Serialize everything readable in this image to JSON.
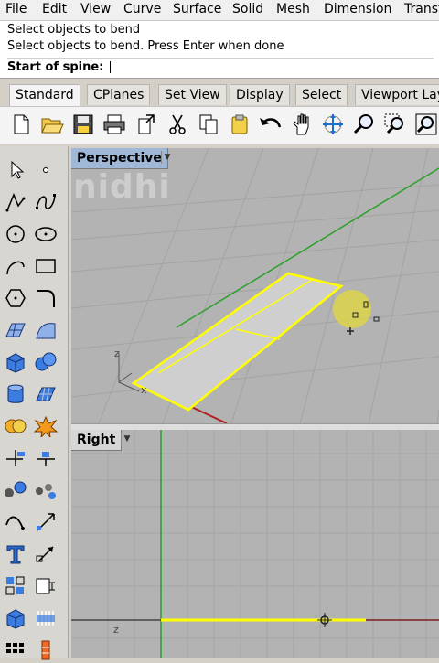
{
  "menu": [
    "File",
    "Edit",
    "View",
    "Curve",
    "Surface",
    "Solid",
    "Mesh",
    "Dimension",
    "Transf"
  ],
  "command_history": [
    "Select objects to bend",
    "Select objects to bend. Press Enter when done"
  ],
  "command_prompt": "Start of spine:",
  "command_input_value": "",
  "tabs": [
    "Standard",
    "CPlanes",
    "Set View",
    "Display",
    "Select",
    "Viewport Layo"
  ],
  "active_tab": "Standard",
  "toolbar_icons": [
    "new-icon",
    "open-icon",
    "save-icon",
    "print-icon",
    "import-icon",
    "cut-icon",
    "copy-icon",
    "paste-icon",
    "undo-icon",
    "pan-icon",
    "rotate-view-icon",
    "zoom-icon",
    "zoom-window-icon",
    "zoom-extents-icon"
  ],
  "sidebar_icons": [
    "select-arrow-icon",
    "point-icon",
    "polyline-icon",
    "curve-icon",
    "circle-icon",
    "ellipse-icon",
    "arc-icon",
    "rectangle-icon",
    "polygon-icon",
    "fillet-curve-icon",
    "surface-points-icon",
    "surface-edge-icon",
    "box-icon",
    "sphere-icon",
    "cylinder-icon",
    "network-surface-icon",
    "boolean-icon",
    "explode-icon",
    "trim-icon",
    "split-icon",
    "loft-icon",
    "revolve-icon",
    "curve-from-object-icon",
    "project-icon",
    "text-icon",
    "dimension-icon",
    "array-icon",
    "group-icon",
    "mesh-icon",
    "block-icon",
    "grid-icon",
    "control-points-icon"
  ],
  "viewports": {
    "perspective": {
      "label": "Perspective",
      "axis_z": "z",
      "axis_x": "x"
    },
    "right": {
      "label": "Right",
      "axis_z": "z"
    }
  },
  "watermark": "nidhi",
  "colors": {
    "selection": "#ffff00",
    "grid_bg": "#b3b3b3",
    "grid_line": "#a2a2a2",
    "x_axis": "#b02020",
    "y_axis": "#2aa02a",
    "highlight": "#e8e04a"
  }
}
